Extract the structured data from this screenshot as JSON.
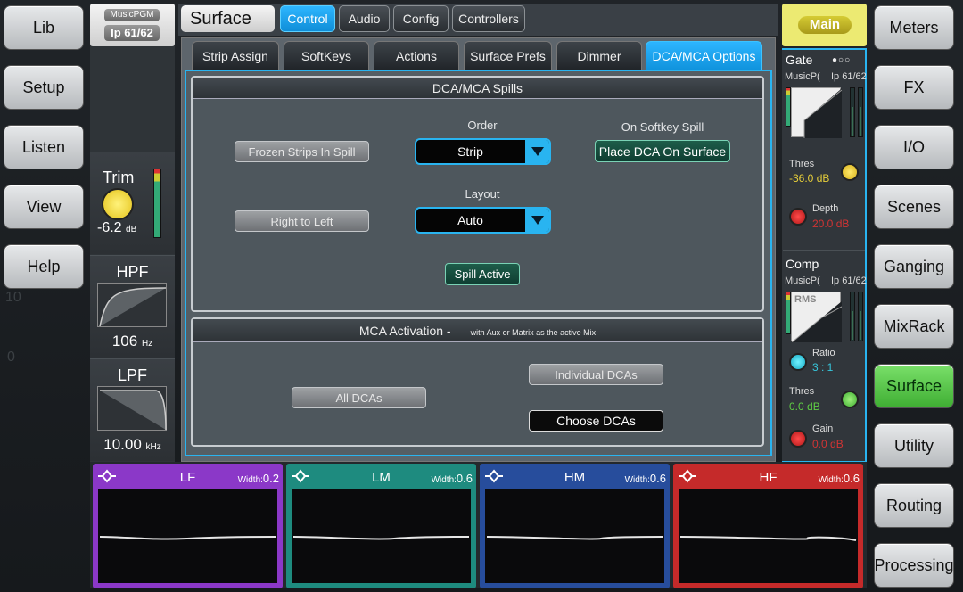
{
  "left_nav": [
    "Lib",
    "Setup",
    "Listen",
    "View",
    "Help"
  ],
  "right_nav": [
    "Meters",
    "FX",
    "I/O",
    "Scenes",
    "Ganging",
    "MixRack",
    "Surface",
    "Utility",
    "Routing",
    "Processing"
  ],
  "bg_scale": [
    "10",
    "0"
  ],
  "channel": {
    "name": "MusicPGM",
    "ip": "Ip 61/62",
    "trim_label": "Trim",
    "trim_value": "-6.2",
    "trim_unit": "dB",
    "hpf_label": "HPF",
    "hpf_value": "106",
    "hpf_unit": "Hz",
    "lpf_label": "LPF",
    "lpf_value": "10.00",
    "lpf_unit": "kHz"
  },
  "header": {
    "title": "Surface",
    "tabs": [
      "Control",
      "Audio",
      "Config",
      "Controllers"
    ],
    "active_tab": "Control"
  },
  "sub_tabs": [
    "Strip Assign",
    "SoftKeys",
    "Actions",
    "Surface Prefs",
    "Dimmer",
    "DCA/MCA Options"
  ],
  "spills": {
    "title": "DCA/MCA Spills",
    "frozen_strips": "Frozen Strips In Spill",
    "right_to_left": "Right to Left",
    "order_label": "Order",
    "order_value": "Strip",
    "layout_label": "Layout",
    "layout_value": "Auto",
    "softkey_label": "On Softkey Spill",
    "place_dca": "Place DCA On Surface",
    "spill_active": "Spill Active"
  },
  "mca": {
    "title": "MCA Activation -",
    "subtitle": "with Aux or Matrix as the active Mix",
    "all_dcas": "All DCAs",
    "individual_dcas": "Individual DCAs",
    "choose_dcas": "Choose DCAs"
  },
  "main_button": "Main",
  "gate": {
    "title": "Gate",
    "name": "MusicP(",
    "ip": "Ip 61/62",
    "thres_label": "Thres",
    "thres_value": "-36.0",
    "thres_unit": "dB",
    "depth_label": "Depth",
    "depth_value": "20.0",
    "depth_unit": "dB"
  },
  "comp": {
    "title": "Comp",
    "name": "MusicP(",
    "ip": "Ip 61/62",
    "rms": "RMS",
    "ratio_label": "Ratio",
    "ratio_value": "3 : 1",
    "thres_label": "Thres",
    "thres_value": "0.0",
    "thres_unit": "dB",
    "gain_label": "Gain",
    "gain_value": "0.0",
    "gain_unit": "dB"
  },
  "eq": [
    {
      "band": "LF",
      "width_label": "Width:",
      "width_value": "0.2",
      "color": "#8b38c8"
    },
    {
      "band": "LM",
      "width_label": "Width:",
      "width_value": "0.6",
      "color": "#1e8b7f"
    },
    {
      "band": "HM",
      "width_label": "Width:",
      "width_value": "0.6",
      "color": "#274d9c"
    },
    {
      "band": "HF",
      "width_label": "Width:",
      "width_value": "0.6",
      "color": "#c52a2a"
    }
  ]
}
